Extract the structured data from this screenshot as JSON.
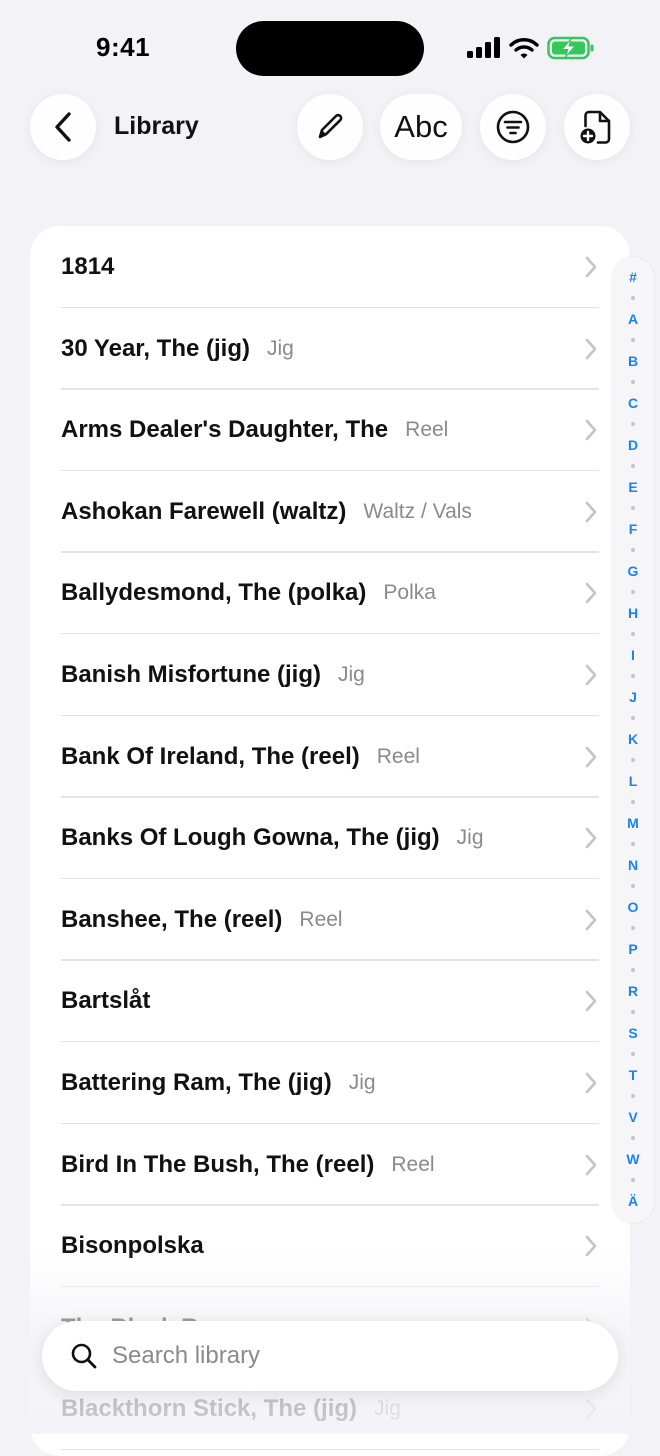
{
  "status_bar": {
    "time": "9:41"
  },
  "toolbar": {
    "title": "Library",
    "abc_label": "Abc"
  },
  "rows": [
    {
      "title": "1814",
      "type": ""
    },
    {
      "title": "30 Year, The (jig)",
      "type": "Jig"
    },
    {
      "title": "Arms Dealer's Daughter, The",
      "type": "Reel"
    },
    {
      "title": "Ashokan Farewell (waltz)",
      "type": "Waltz / Vals"
    },
    {
      "title": "Ballydesmond, The (polka)",
      "type": "Polka"
    },
    {
      "title": "Banish Misfortune (jig)",
      "type": "Jig"
    },
    {
      "title": "Bank Of Ireland, The (reel)",
      "type": "Reel"
    },
    {
      "title": "Banks Of Lough Gowna, The (jig)",
      "type": "Jig"
    },
    {
      "title": "Banshee, The (reel)",
      "type": "Reel"
    },
    {
      "title": "Bartslåt",
      "type": ""
    },
    {
      "title": "Battering Ram, The (jig)",
      "type": "Jig"
    },
    {
      "title": "Bird In The Bush, The (reel)",
      "type": "Reel"
    },
    {
      "title": "Bisonpolska",
      "type": ""
    },
    {
      "title": "The Black R",
      "type": ""
    },
    {
      "title": "Blackthorn Stick, The (jig)",
      "type": "Jig"
    }
  ],
  "index_letters": [
    "#",
    "A",
    "B",
    "C",
    "D",
    "E",
    "F",
    "G",
    "H",
    "I",
    "J",
    "K",
    "L",
    "M",
    "N",
    "O",
    "P",
    "R",
    "S",
    "T",
    "V",
    "W",
    "Ä"
  ],
  "search": {
    "placeholder": "Search library"
  },
  "colors": {
    "accent": "#1a82f5",
    "background": "#f2f2f7",
    "battery": "#34c759"
  }
}
